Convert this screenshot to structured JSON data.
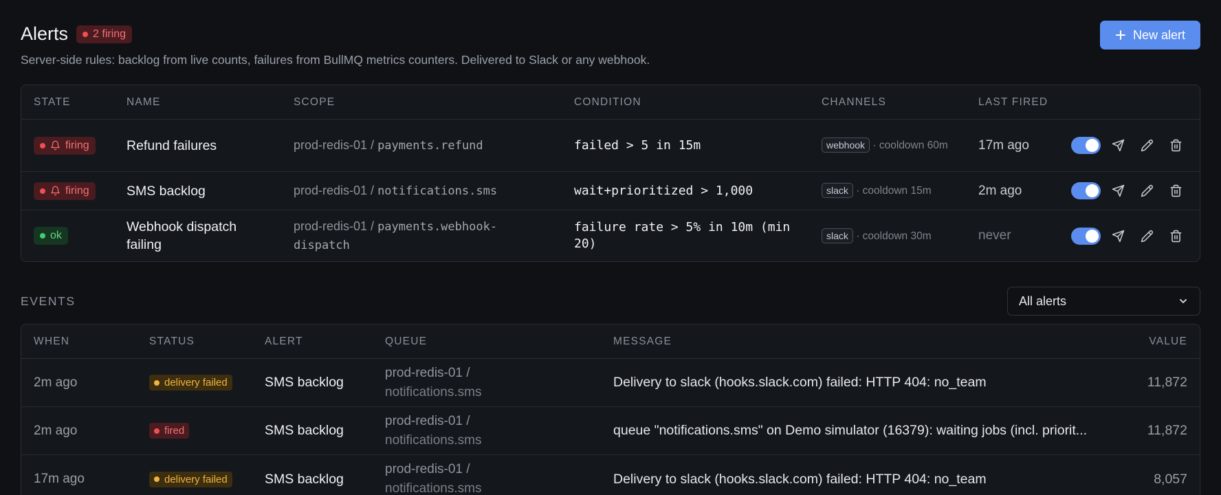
{
  "header": {
    "title": "Alerts",
    "firing_badge": "2 firing",
    "subtitle": "Server-side rules: backlog from live counts, failures from BullMQ metrics counters. Delivered to Slack or any webhook.",
    "new_alert_label": "New alert"
  },
  "rules": {
    "columns": [
      "STATE",
      "NAME",
      "SCOPE",
      "CONDITION",
      "CHANNELS",
      "LAST FIRED"
    ],
    "rows": [
      {
        "state": "firing",
        "name": "Refund failures",
        "scope_server": "prod-redis-01 / ",
        "scope_queue": "payments.refund",
        "condition": "failed > 5 in 15m",
        "channel": "webhook",
        "cooldown": "· cooldown 60m",
        "last_fired": "17m ago",
        "enabled": true
      },
      {
        "state": "firing",
        "name": "SMS backlog",
        "scope_server": "prod-redis-01 / ",
        "scope_queue": "notifications.sms",
        "condition": "wait+prioritized > 1,000",
        "channel": "slack",
        "cooldown": "· cooldown 15m",
        "last_fired": "2m ago",
        "enabled": true
      },
      {
        "state": "ok",
        "name": "Webhook dispatch failing",
        "scope_server": "prod-redis-01 / ",
        "scope_queue": "payments.webhook-dispatch",
        "condition": "failure rate > 5% in 10m (min 20)",
        "channel": "slack",
        "cooldown": "· cooldown 30m",
        "last_fired": "never",
        "enabled": true
      }
    ]
  },
  "events": {
    "title": "EVENTS",
    "filter_value": "All alerts",
    "columns": [
      "WHEN",
      "STATUS",
      "ALERT",
      "QUEUE",
      "MESSAGE",
      "VALUE"
    ],
    "rows": [
      {
        "when": "2m ago",
        "status": "delivery failed",
        "alert": "SMS backlog",
        "queue_server": "prod-redis-01 /",
        "queue_name": "notifications.sms",
        "message": "Delivery to slack (hooks.slack.com) failed: HTTP 404: no_team",
        "value": "11,872"
      },
      {
        "when": "2m ago",
        "status": "fired",
        "alert": "SMS backlog",
        "queue_server": "prod-redis-01 /",
        "queue_name": "notifications.sms",
        "message": "queue \"notifications.sms\" on Demo simulator (16379): waiting jobs (incl. priorit...",
        "value": "11,872"
      },
      {
        "when": "17m ago",
        "status": "delivery failed",
        "alert": "SMS backlog",
        "queue_server": "prod-redis-01 /",
        "queue_name": "notifications.sms",
        "message": "Delivery to slack (hooks.slack.com) failed: HTTP 404: no_team",
        "value": "8,057"
      }
    ]
  },
  "colors": {
    "accent": "#5b8def",
    "firing": "#f04e55",
    "ok": "#3ecf6e",
    "delivery_failed": "#f0b43c"
  },
  "icons": {
    "state_firing": "bell-icon",
    "test_send": "send-icon",
    "edit": "pencil-icon",
    "delete": "trash-icon",
    "add": "plus-icon",
    "dropdown": "chevron-down-icon"
  }
}
